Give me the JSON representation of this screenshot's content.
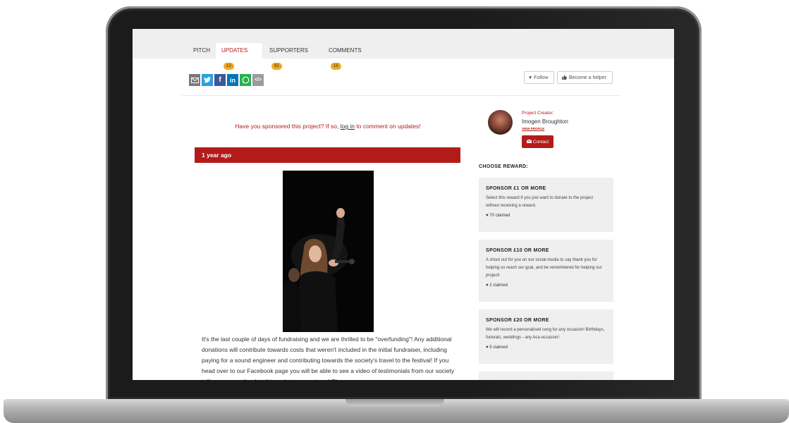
{
  "tabs": [
    {
      "label": "PITCH",
      "badge": ""
    },
    {
      "label": "UPDATES",
      "badge": "13"
    },
    {
      "label": "SUPPORTERS",
      "badge": "92"
    },
    {
      "label": "COMMENTS",
      "badge": "16"
    }
  ],
  "share_icons": [
    "email-icon",
    "twitter-icon",
    "facebook-icon",
    "linkedin-icon",
    "whatsapp-icon",
    "embed-icon"
  ],
  "actions": {
    "follow_label": "Follow",
    "helper_label": "Become a helper"
  },
  "notice": {
    "before": "Have you sponsored this project? If so,",
    "link": "log in",
    "after": "to comment on updates!"
  },
  "update": {
    "time": "1 year ago",
    "text": "It's the last couple of days of fundraising and we are thrilled to be \"overfunding\"! Any additional donations will contribute towards costs that weren't included in the initial fundraiser, including paying for a sound engineer and contributing towards the society's travel to the festival! If you head over to our Facebook page you will be able to see a video of testimonials from our society telling you exactly what this project means to us! Please"
  },
  "creator": {
    "label": "Project Creator:",
    "name": "Imogen Broughton",
    "view_profile": "VIEW PROFILE",
    "contact_label": "Contact"
  },
  "rewards_heading": "CHOOSE REWARD:",
  "rewards": [
    {
      "title": "SPONSOR £1 OR MORE",
      "desc": "Select this reward if you just want to donate to the project without receiving a reward.",
      "claimed": "70 claimed"
    },
    {
      "title": "SPONSOR £10 OR MORE",
      "desc": "A shout out for you on our social media to say thank you for helping us reach our goal, and be remembered for helping our project!",
      "claimed": "2 claimed"
    },
    {
      "title": "SPONSOR £20 OR MORE",
      "desc": "We will record a personalised song for any occasion! Birthdays, funerals, weddings - any Aca-occasion!",
      "claimed": "5 claimed"
    }
  ],
  "colors": {
    "brand_red": "#b31b1b",
    "badge_orange": "#f0a91e"
  }
}
